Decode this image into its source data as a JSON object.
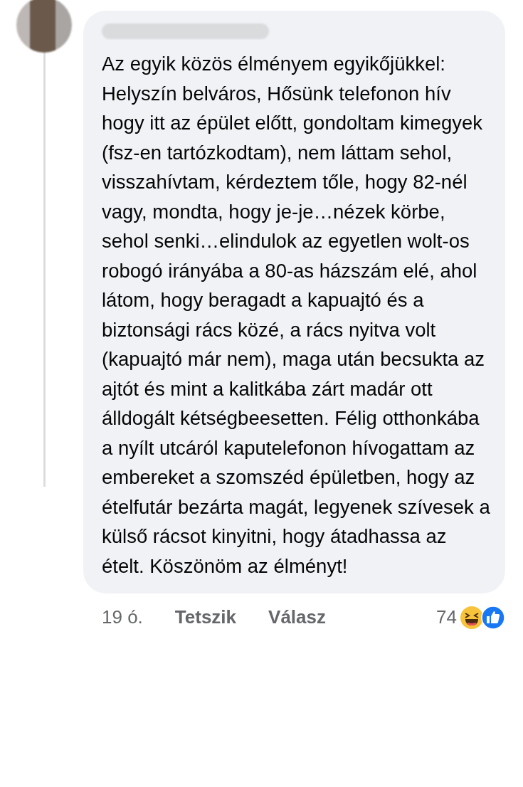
{
  "comment": {
    "paragraphs": [
      "Az egyik közös élményem egyikőjükkel:",
      "Helyszín belváros, Hősünk telefonon hív hogy itt az épület előtt, gondoltam kimegyek (fsz-en tartózkodtam), nem láttam sehol, visszahívtam, kérdeztem tőle, hogy 82-nél vagy, mondta, hogy je-je…nézek körbe, sehol senki…elindulok az egyetlen wolt-os robogó irányába a 80-as házszám elé, ahol látom, hogy beragadt a kapuajtó és a biztonsági rács közé, a rács nyitva volt (kapuajtó már nem), maga után becsukta az ajtót és mint a kalitkába zárt madár ott álldogált kétségbeesetten. Félig otthonkába a nyílt utcáról kaputelefonon hívogattam az embereket a szomszéd épületben, hogy az ételfutár bezárta magát, legyenek szívesek a külső rácsot kinyitni, hogy átadhassa az ételt. Köszönöm az élményt!"
    ]
  },
  "footer": {
    "time": "19 ó.",
    "actions": [
      "Tetszik",
      "Válasz"
    ],
    "reaction_count": "74"
  }
}
